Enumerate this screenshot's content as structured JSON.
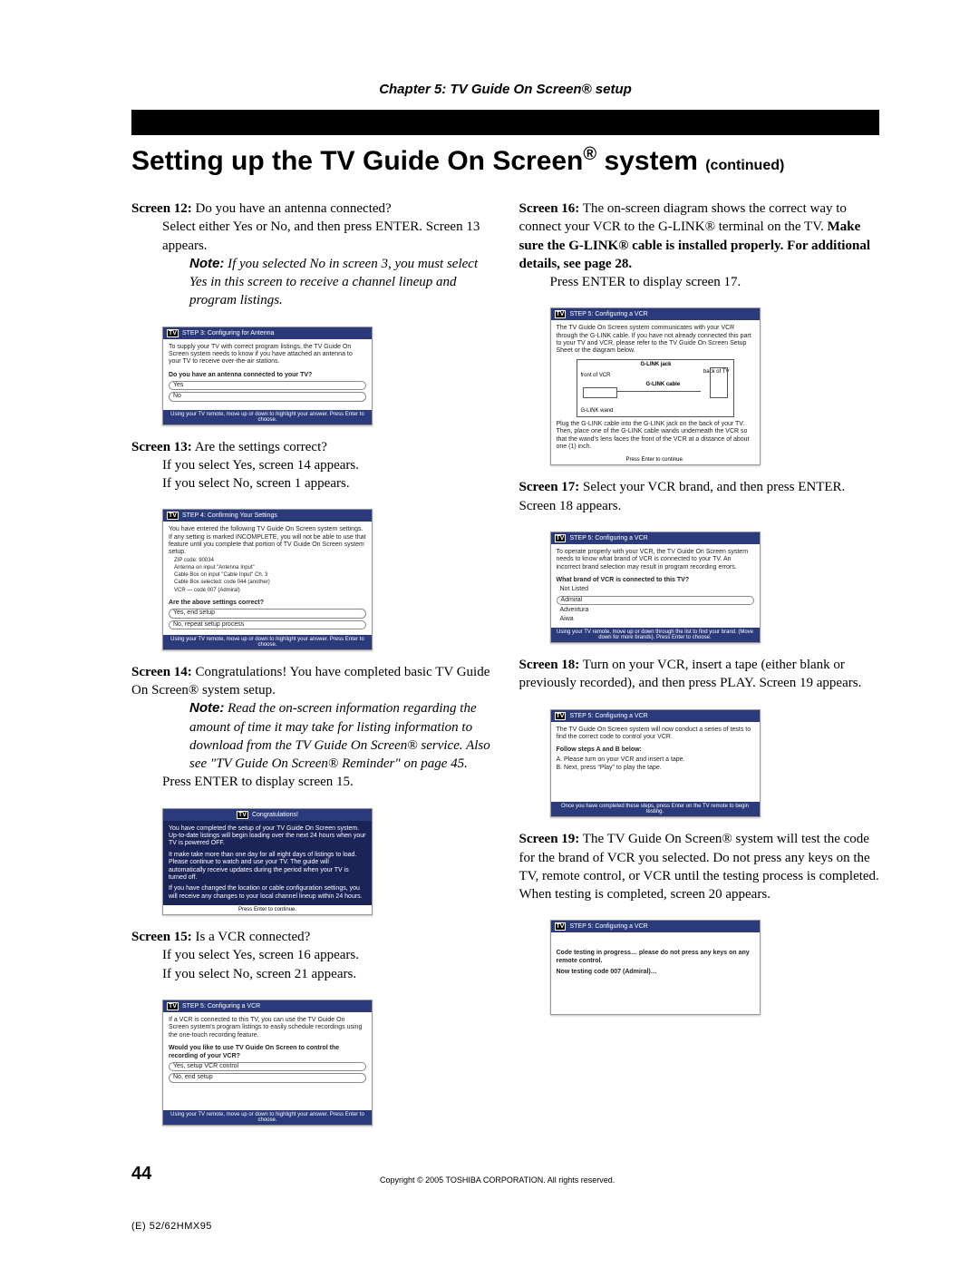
{
  "chapter_heading": "Chapter 5: TV Guide On Screen® setup",
  "page_title_main": "Setting up the TV Guide On Screen",
  "page_title_reg": "®",
  "page_title_system": " system ",
  "page_title_cont": "(continued)",
  "left": {
    "s12": {
      "label": "Screen 12:",
      "lead": " Do you have an antenna connected?",
      "body": "Select either Yes or No, and then press ENTER. Screen 13 appears.",
      "note_label": "Note:",
      "note": " If you selected No in screen 3, you must select Yes in this screen to receive a channel lineup and program listings.",
      "thumb": {
        "hdr": "STEP 3: Configuring for Antenna",
        "intro": "To supply your TV with correct program listings, the TV Guide On Screen system needs to know if you have attached an antenna to your TV to receive over-the-air stations.",
        "q": "Do you have an antenna connected to your TV?",
        "opt1": "Yes",
        "opt2": "No",
        "foot": "Using your TV remote, move up or down to highlight your answer. Press Enter to choose."
      }
    },
    "s13": {
      "label": "Screen 13:",
      "lead": " Are the settings correct?",
      "body1": "If you select Yes, screen 14 appears.",
      "body2": "If you select No, screen 1 appears.",
      "thumb": {
        "hdr": "STEP 4: Confirming Your Settings",
        "intro": "You have entered the following TV Guide On Screen system settings. If any setting is marked INCOMPLETE, you will not be able to use that feature until you complete that portion of TV Guide On Screen system setup.",
        "l1": "ZIP code: 90034",
        "l2": "Antenna on input \"Antenna Input\"",
        "l3": "Cable Box on input \"Cable Input\" Ch. 3",
        "l4": "Cable Box selected: code 044 (another)",
        "l5": "VCR — code 007 (Admiral)",
        "q": "Are the above settings correct?",
        "opt1": "Yes, end setup",
        "opt2": "No, repeat setup process",
        "foot": "Using your TV remote, move up or down to highlight your answer. Press Enter to choose."
      }
    },
    "s14": {
      "label": "Screen 14:",
      "lead": " Congratulations! You have completed basic TV Guide On Screen® system setup.",
      "note_label": "Note:",
      "note": " Read the on-screen information regarding the amount of time it may take for listing information to download from the TV Guide On Screen® service. Also see \"TV Guide On Screen® Reminder\" on page 45.",
      "tail": "Press ENTER to display screen 15.",
      "thumb": {
        "hdr": "Congratulations!",
        "p1": "You have completed the setup of your TV Guide On Screen system. Up-to-date listings will begin loading over the next 24 hours when your TV is powered OFF.",
        "p2": "It make take more than one day for all eight days of listings to load. Please continue to watch and use your TV. The guide will automatically receive updates during the period when your TV is turned off.",
        "p3": "If you have changed the location or cable configuration settings, you will receive any changes to your local channel lineup within 24 hours.",
        "foot": "Press Enter to continue."
      }
    },
    "s15": {
      "label": "Screen 15:",
      "lead": " Is a VCR connected?",
      "body1": "If you select Yes, screen 16 appears.",
      "body2": "If you select No, screen 21 appears.",
      "thumb": {
        "hdr": "STEP 5: Configuring a VCR",
        "intro": "If a VCR is connected to this TV, you can use the TV Guide On Screen system's program listings to easily schedule recordings using the one-touch recording feature.",
        "q": "Would you like to use TV Guide On Screen to control the recording of your VCR?",
        "opt1": "Yes, setup VCR control",
        "opt2": "No, end setup",
        "foot": "Using your TV remote, move up or down to highlight your answer. Press Enter to choose."
      }
    }
  },
  "right": {
    "s16": {
      "label": "Screen 16:",
      "lead": " The on-screen diagram shows the correct way to connect your VCR to the G-LINK® terminal on the TV. ",
      "bold": "Make sure the G-LINK® cable is installed properly. For additional details, see page 28.",
      "tail": "Press ENTER to display screen 17.",
      "thumb": {
        "hdr": "STEP 5: Configuring a VCR",
        "intro": "The TV Guide On Screen system communicates with your VCR through the G-LINK cable. If you have not already connected this part to your TV and VCR, please refer to the TV Guide On Screen Setup Sheet or the diagram below.",
        "d_front": "front of VCR",
        "d_glink": "G-LINK jack",
        "d_back": "back of TV",
        "d_cable": "G-LINK cable",
        "d_wand": "G-LINK wand",
        "post": "Plug the G-LINK cable into the G-LINK jack on the back of your TV. Then, place one of the G-LINK cable wands underneath the VCR so that the wand's lens faces the front of the VCR at a distance of about one (1) inch.",
        "foot": "Press Enter to continue."
      }
    },
    "s17": {
      "label": "Screen 17:",
      "lead": " Select your VCR brand, and then press ENTER. Screen 18 appears.",
      "thumb": {
        "hdr": "STEP 5: Configuring a VCR",
        "intro": "To operate properly with your VCR, the TV Guide On Screen system needs to know what brand of VCR is connected to your TV. An incorrect brand selection may result in program recording errors.",
        "q": "What brand of VCR is connected to this TV?",
        "opt1": "Not Listed",
        "opt2": "Admiral",
        "opt3": "Adventura",
        "opt4": "Aiwa",
        "foot": "Using your TV remote, move up or down through the list to find your brand. (Move down for more brands). Press Enter to choose."
      }
    },
    "s18": {
      "label": "Screen 18:",
      "lead": " Turn on your VCR, insert a tape (either blank or previously recorded), and then press PLAY. Screen 19 appears.",
      "thumb": {
        "hdr": "STEP 5: Configuring a VCR",
        "intro": "The TV Guide On Screen system will now conduct a series of tests to find the correct code to control your VCR.",
        "q": "Follow steps A and B below:",
        "la": "A.   Please turn on your VCR and insert a tape.",
        "lb": "B.   Next, press \"Play\" to play the tape.",
        "foot": "Once you have completed these steps, press Enter on the TV remote to begin testing."
      }
    },
    "s19": {
      "label": "Screen 19:",
      "lead": " The TV Guide On Screen® system will test the code for the brand of VCR you selected. Do not press any keys on the TV, remote control, or VCR until the testing process is completed. When testing is completed, screen 20 appears.",
      "thumb": {
        "hdr": "STEP 5: Configuring a VCR",
        "l1": "Code testing in progress… please do not press any keys on any remote control.",
        "l2": "Now testing code 007 (Admiral)…"
      }
    }
  },
  "page_number": "44",
  "copyright": "Copyright © 2005 TOSHIBA CORPORATION. All rights reserved.",
  "footer_code": "(E) 52/62HMX95"
}
